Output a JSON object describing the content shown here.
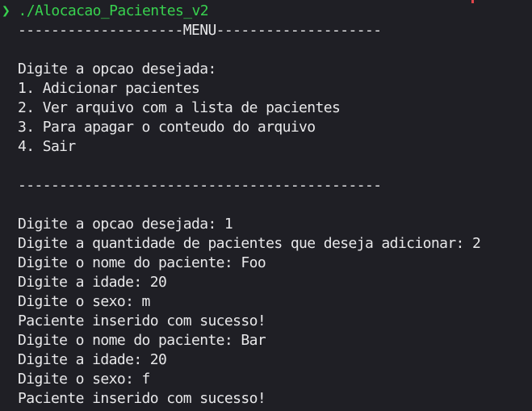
{
  "terminal": {
    "prompt_symbol": "❯",
    "command": " ./Alocacao_Pacientes_v2",
    "accent_color": "#38d14f",
    "lines": [
      "--------------------MENU--------------------",
      "",
      "Digite a opcao desejada:",
      "1. Adicionar pacientes",
      "2. Ver arquivo com a lista de pacientes",
      "3. Para apagar o conteudo do arquivo",
      "4. Sair",
      "",
      "--------------------------------------------",
      "",
      "Digite a opcao desejada: 1",
      "Digite a quantidade de pacientes que deseja adicionar: 2",
      "Digite o nome do paciente: Foo",
      "Digite a idade: 20",
      "Digite o sexo: m",
      "Paciente inserido com sucesso!",
      "Digite o nome do paciente: Bar",
      "Digite a idade: 20",
      "Digite o sexo: f",
      "Paciente inserido com sucesso!"
    ]
  }
}
